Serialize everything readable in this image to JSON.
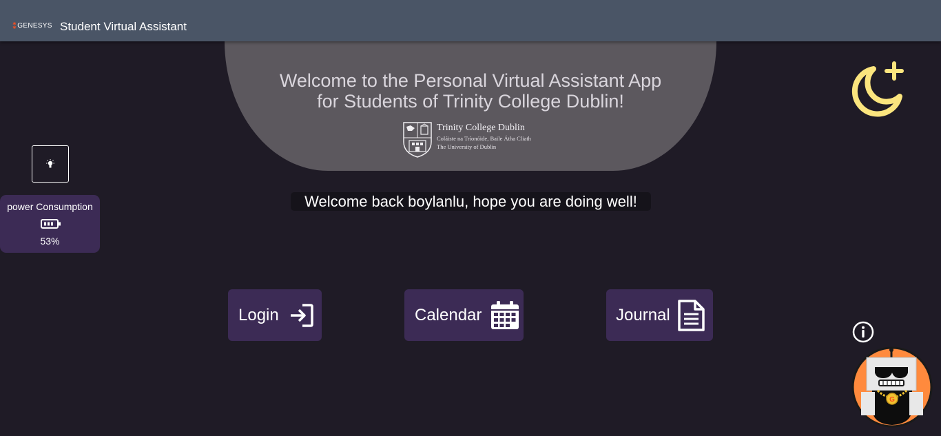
{
  "header": {
    "brand_mark": "⁑",
    "brand_name": "GENESYS",
    "app_title": "Student Virtual Assistant"
  },
  "hero": {
    "line1": "Welcome to the Personal Virtual Assistant App",
    "line2": "for Students of Trinity College Dublin!",
    "logo": {
      "name": "Trinity College Dublin",
      "subtitle_irish": "Coláiste na Tríonóide, Baile Átha Cliath",
      "subtitle_english": "The University of Dublin"
    }
  },
  "greeting": "Welcome back boylanlu, hope you are doing well!",
  "power": {
    "title": "power Consumption",
    "value": "53%",
    "icon": "battery-icon"
  },
  "icons": {
    "theme": "moon-plus-icon",
    "light": "lightbulb-icon",
    "info": "info-icon",
    "avatar": "robot-avatar-icon"
  },
  "nav": {
    "login": {
      "label": "Login",
      "icon": "login-icon"
    },
    "calendar": {
      "label": "Calendar",
      "icon": "calendar-icon"
    },
    "journal": {
      "label": "Journal",
      "icon": "document-icon"
    }
  },
  "colors": {
    "background": "#1f1b26",
    "header": "#4a5566",
    "hero": "#5c585e",
    "button": "#3c2b55",
    "moon": "#fbe57e",
    "avatar_bg": "#ff8a3d",
    "brand": "#ff4f1f"
  }
}
